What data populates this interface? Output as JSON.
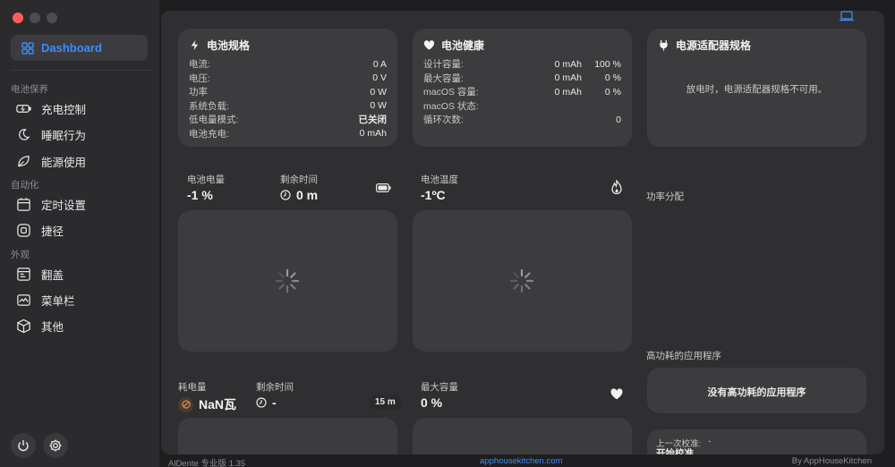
{
  "app": {
    "name": "AlDente"
  },
  "sidebar": {
    "dashboard_label": "Dashboard",
    "sections": [
      {
        "title": "电池保养",
        "items": [
          {
            "label": "充电控制",
            "icon": "battery-charging-icon"
          },
          {
            "label": "睡眠行为",
            "icon": "moon-icon"
          },
          {
            "label": "能源使用",
            "icon": "leaf-icon"
          }
        ]
      },
      {
        "title": "自动化",
        "items": [
          {
            "label": "定时设置",
            "icon": "calendar-icon"
          },
          {
            "label": "捷径",
            "icon": "shortcuts-icon"
          }
        ]
      },
      {
        "title": "外观",
        "items": [
          {
            "label": "翻盖",
            "icon": "laptop-lid-icon"
          },
          {
            "label": "菜单栏",
            "icon": "menubar-icon"
          },
          {
            "label": "其他",
            "icon": "cube-icon"
          }
        ]
      }
    ]
  },
  "battery_spec": {
    "title": "电池规格",
    "rows": [
      {
        "key": "电流:",
        "value": "0 A"
      },
      {
        "key": "电压:",
        "value": "0 V"
      },
      {
        "key": "功率",
        "value": "0 W"
      },
      {
        "key": "系统负载:",
        "value": "0 W"
      },
      {
        "key": "低电量模式:",
        "value": "已关闭"
      },
      {
        "key": "电池充电:",
        "value": "0 mAh"
      }
    ]
  },
  "battery_health": {
    "title": "电池健康",
    "rows": [
      {
        "key": "设计容量:",
        "value": "0 mAh",
        "value2": "100 %"
      },
      {
        "key": "最大容量:",
        "value": "0 mAh",
        "value2": "0 %"
      },
      {
        "key": "macOS 容量:",
        "value": "0 mAh",
        "value2": "0 %"
      },
      {
        "key": "macOS 状态:",
        "value": "",
        "value2": ""
      },
      {
        "key": "循环次数:",
        "value": "",
        "value2": "0"
      }
    ]
  },
  "power_adapter": {
    "title": "电源适配器规格",
    "message": "放电时，电源适配器规格不可用。"
  },
  "battery_level": {
    "label": "电池电量",
    "value": "-1 %",
    "remaining_label": "剩余时间",
    "remaining_value": "0 m"
  },
  "battery_temp": {
    "label": "电池温度",
    "value": "-1ºC"
  },
  "power_distribution": {
    "label": "功率分配"
  },
  "consumption": {
    "label": "耗电量",
    "value": "NaN瓦",
    "remaining_label": "剩余时间",
    "remaining_value": "-",
    "interval": "15 m"
  },
  "max_capacity": {
    "label": "最大容量",
    "value": "0 %"
  },
  "high_power_apps": {
    "label": "高功耗的应用程序",
    "message": "没有高功耗的应用程序"
  },
  "calibration": {
    "last_label": "上一次校准:",
    "last_value": "-",
    "start_label": "开始校准"
  },
  "footer": {
    "version": "AlDente 专业版 1.35",
    "link": "apphousekitchen.com",
    "credit": "By AppHouseKitchen"
  },
  "colors": {
    "accent": "#3d8cf7",
    "close": "#ff5f57",
    "orange": "#e0843a"
  }
}
